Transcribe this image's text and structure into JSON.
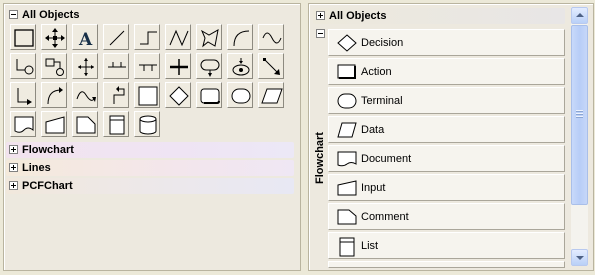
{
  "left_panel": {
    "header": "All Objects",
    "tool_icons": [
      "rectangle-icon",
      "move-cross-icon",
      "text-icon",
      "line-icon",
      "step-line-icon",
      "polyline-icon",
      "polygon-icon",
      "arc-icon",
      "sine-wave-icon",
      "connector-link-circle-icon",
      "connector-circle-icon",
      "spline-cross-icon",
      "bus-line-icon",
      "tee-bar-icon",
      "crossing-line-icon",
      "terminal-connector-icon",
      "loop-connector-icon",
      "diagonal-connector-icon",
      "elbow-connector-icon",
      "curve-connector-icon",
      "s-curve-connector-icon",
      "step-connector-icon",
      "square-icon",
      "diamond-icon",
      "rounded-rect-icon",
      "oval-icon",
      "parallelogram-icon",
      "document-icon",
      "input-icon",
      "page-icon",
      "card-icon",
      "cylinder-icon"
    ],
    "categories": [
      {
        "label": "Flowchart"
      },
      {
        "label": "Lines"
      },
      {
        "label": "PCFChart"
      }
    ]
  },
  "right_panel": {
    "header": "All Objects",
    "group_label": "Flowchart",
    "items": [
      {
        "label": "Decision",
        "icon": "decision-diamond-icon"
      },
      {
        "label": "Action",
        "icon": "action-rect-icon"
      },
      {
        "label": "Terminal",
        "icon": "terminal-oval-icon"
      },
      {
        "label": "Data",
        "icon": "data-parallelogram-icon"
      },
      {
        "label": "Document",
        "icon": "document-shape-icon"
      },
      {
        "label": "Input",
        "icon": "input-shape-icon"
      },
      {
        "label": "Comment",
        "icon": "comment-shape-icon"
      },
      {
        "label": "List",
        "icon": "list-shape-icon"
      }
    ]
  }
}
